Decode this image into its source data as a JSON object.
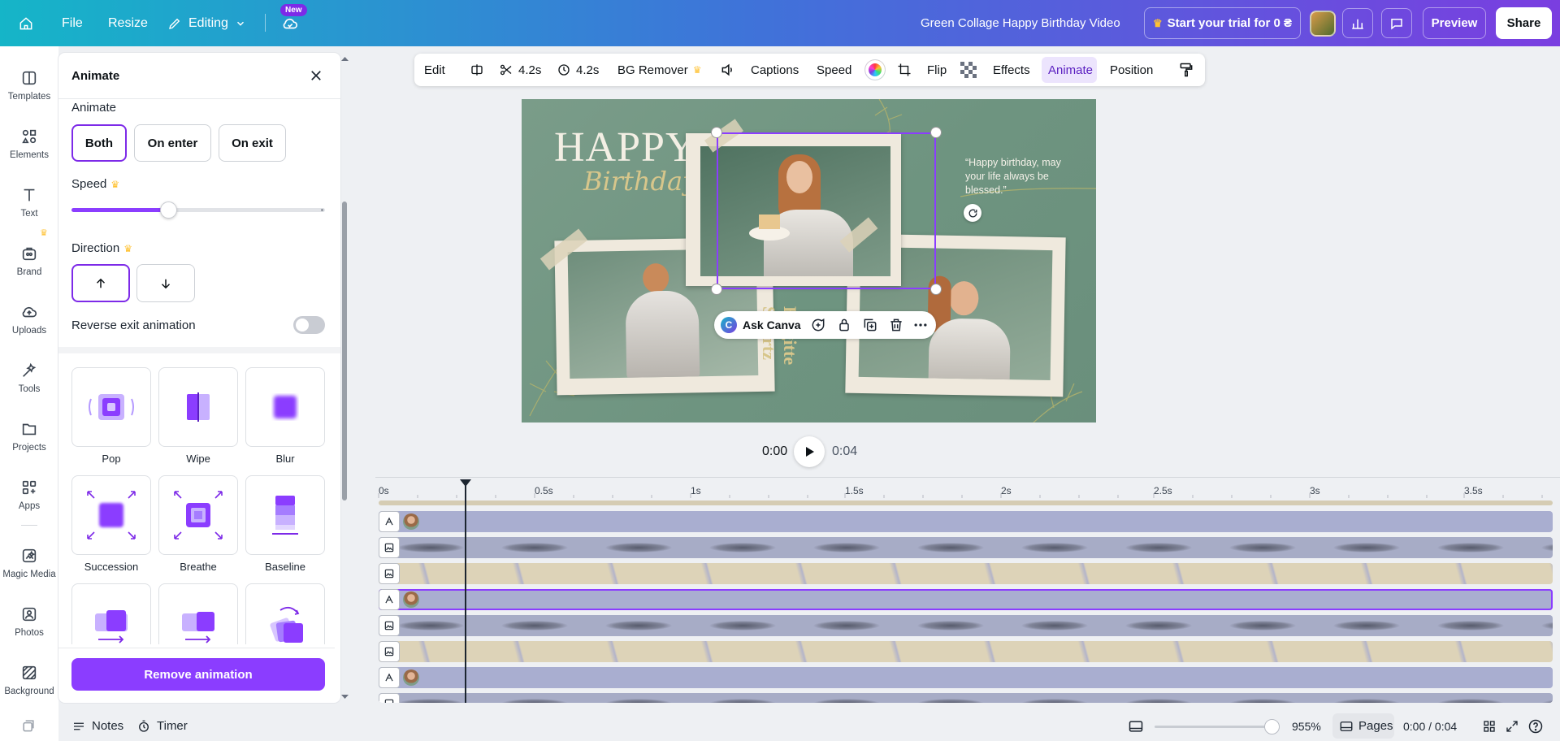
{
  "topbar": {
    "file_label": "File",
    "resize_label": "Resize",
    "editing_label": "Editing",
    "new_badge": "New",
    "doc_title": "Green Collage Happy Birthday Video",
    "trial_label": "Start your trial for 0 ₴",
    "preview_label": "Preview",
    "share_label": "Share"
  },
  "rail": {
    "items": [
      {
        "label": "Templates",
        "icon": "templates-icon"
      },
      {
        "label": "Elements",
        "icon": "elements-icon"
      },
      {
        "label": "Text",
        "icon": "text-icon"
      },
      {
        "label": "Brand",
        "icon": "brand-icon"
      },
      {
        "label": "Uploads",
        "icon": "uploads-icon"
      },
      {
        "label": "Tools",
        "icon": "tools-icon"
      },
      {
        "label": "Projects",
        "icon": "projects-icon"
      },
      {
        "label": "Apps",
        "icon": "apps-icon"
      },
      {
        "label": "Magic Media",
        "icon": "magic-media-icon"
      },
      {
        "label": "Photos",
        "icon": "photos-icon"
      },
      {
        "label": "Background",
        "icon": "background-icon"
      }
    ]
  },
  "panel": {
    "title": "Animate",
    "animate_label": "Animate",
    "modes": [
      "Both",
      "On enter",
      "On exit"
    ],
    "selected_mode": "Both",
    "speed_label": "Speed",
    "speed_fraction": 0.38,
    "direction_label": "Direction",
    "reverse_label": "Reverse exit animation",
    "reverse_on": false,
    "animations": [
      "Pop",
      "Wipe",
      "Blur",
      "Succession",
      "Breathe",
      "Baseline"
    ],
    "remove_label": "Remove animation"
  },
  "context_toolbar": {
    "edit": "Edit",
    "trim_duration": "4.2s",
    "time_duration": "4.2s",
    "bg_remover": "BG Remover",
    "captions": "Captions",
    "speed": "Speed",
    "flip": "Flip",
    "effects": "Effects",
    "animate": "Animate",
    "position": "Position"
  },
  "canvas": {
    "happy": "HAPPY",
    "birthday": "Birthday",
    "quote": "“Happy birthday, may your life always be blessed.”",
    "name_vertical": "Brigitte Swartz"
  },
  "floating_toolbar": {
    "ask_canva": "Ask Canva"
  },
  "player": {
    "current": "0:00",
    "total": "0:04"
  },
  "timeline": {
    "ruler": [
      "0s",
      "0.5s",
      "1s",
      "1.5s",
      "2s",
      "2.5s",
      "3s",
      "3.5s"
    ]
  },
  "bottombar": {
    "notes": "Notes",
    "timer": "Timer",
    "zoom": "955%",
    "pages": "Pages",
    "time": "0:00 / 0:04"
  },
  "colors": {
    "accent": "#8b3dff",
    "canvas_green": "#6e9480"
  }
}
